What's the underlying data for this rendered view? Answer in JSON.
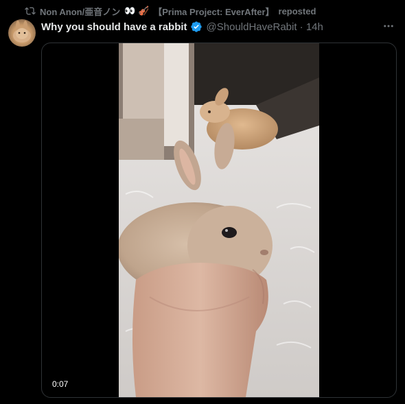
{
  "repost": {
    "icon": "repost-icon",
    "user": "Non Anon/亜音ノン",
    "emoji": "👀 🎻",
    "project": "【Prima Project: EverAfter】",
    "suffix": "reposted"
  },
  "tweet": {
    "author_name": "Why you should have a rabbit",
    "verified_icon": "verified-badge-icon",
    "handle_time": "@ShouldHaveRabit · 14h",
    "more_icon": "more-options-icon"
  },
  "media": {
    "type": "video",
    "timestamp": "0:07",
    "description_icon": "rabbit-video-frame"
  },
  "colors": {
    "background": "#000000",
    "text_primary": "#e7e9ea",
    "text_secondary": "#71767b",
    "verified_blue": "#1d9bf0",
    "border": "#2f3336"
  }
}
